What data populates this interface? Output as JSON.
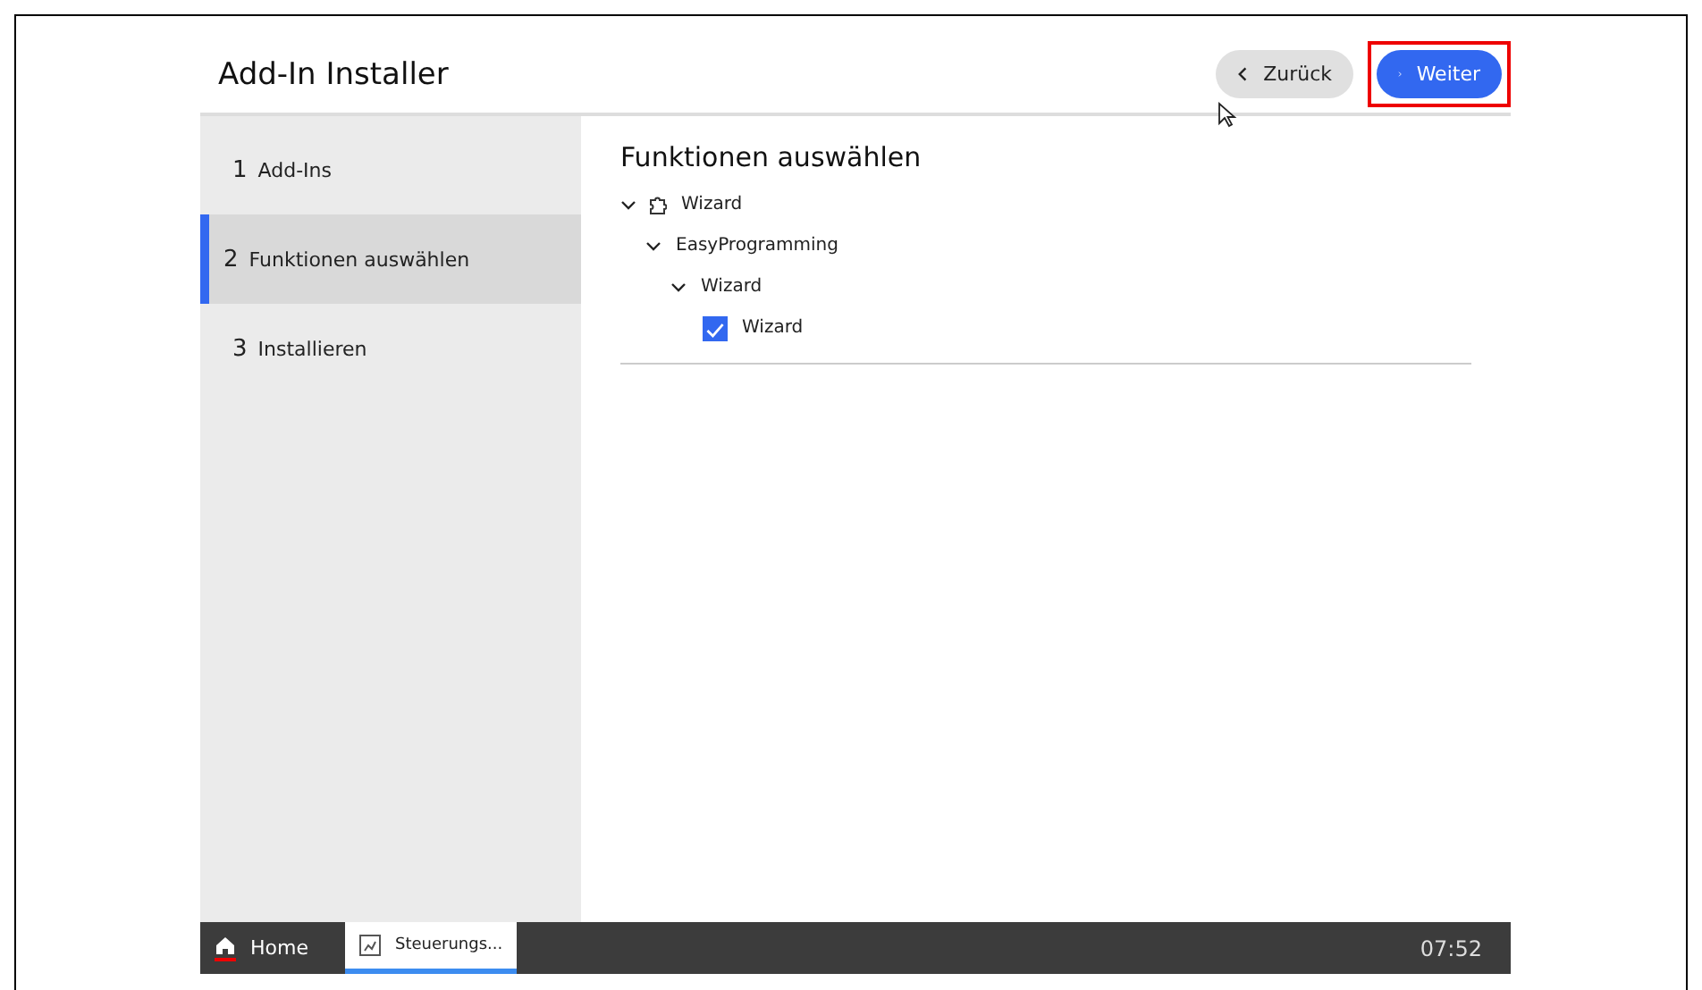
{
  "window": {
    "title": "Add-In Installer"
  },
  "buttons": [
    {
      "kind": "back",
      "label": "Zurück"
    },
    {
      "kind": "next",
      "label": "Weiter",
      "highlighted": true
    }
  ],
  "steps": [
    {
      "number": "1",
      "label": "Add-Ins",
      "selected": false
    },
    {
      "number": "2",
      "label": "Funktionen auswählen",
      "selected": true
    },
    {
      "number": "3",
      "label": "Installieren",
      "selected": false
    }
  ],
  "content": {
    "heading": "Funktionen auswählen",
    "tree": [
      {
        "label": "Wizard",
        "kind": "addin",
        "expanded": true,
        "children": [
          {
            "label": "EasyProgramming",
            "expanded": true,
            "children": [
              {
                "label": "Wizard",
                "expanded": true,
                "children": [
                  {
                    "label": "Wizard",
                    "kind": "feature",
                    "checked": true
                  }
                ]
              }
            ]
          }
        ]
      }
    ]
  },
  "taskbar": {
    "items": [
      {
        "kind": "home",
        "label": "Home",
        "selected": false
      },
      {
        "kind": "app",
        "label": "Steuerungs...",
        "selected": true
      }
    ],
    "clock": "07:52"
  }
}
